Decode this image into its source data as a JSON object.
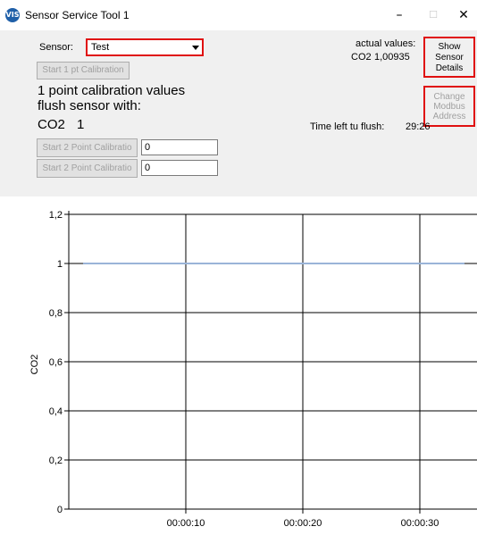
{
  "window": {
    "title": "Sensor Service Tool 1",
    "icon_text": "VIS",
    "minimize": "–",
    "maximize": "☐",
    "close": "✕"
  },
  "sensor": {
    "label": "Sensor:",
    "value": "Test"
  },
  "calibration": {
    "start_1pt": "Start 1 pt Calibration",
    "values_line1": "1 point calibration values",
    "values_line2": "flush sensor with:",
    "gas": "CO2",
    "gas_value": "1",
    "start_2pt_a": "Start 2 Point Calibratio",
    "input_a": "0",
    "start_2pt_b": "Start 2 Point Calibratio",
    "input_b": "0"
  },
  "actual": {
    "label": "actual values:",
    "gas": "CO2",
    "value": "1,00935"
  },
  "buttons": {
    "show_sensor_details": [
      "Show",
      "Sensor",
      "Details"
    ],
    "change_modbus_address": [
      "Change",
      "Modbus",
      "Address"
    ]
  },
  "flush": {
    "label": "Time left tu flush:",
    "value": "29:26"
  },
  "colors": {
    "accent_red": "#e01010",
    "series_line": "#9ab4d8"
  },
  "chart_data": {
    "type": "line",
    "ylabel": "CO2",
    "xlabel": "",
    "ylim": [
      0,
      1.2
    ],
    "yticks": [
      "0",
      "0,2",
      "0,4",
      "0,6",
      "0,8",
      "1",
      "1,2"
    ],
    "xticks": [
      "00:00:10",
      "00:00:20",
      "00:00:30"
    ],
    "grid": true,
    "series": [
      {
        "values": [
          1,
          1
        ]
      }
    ]
  }
}
